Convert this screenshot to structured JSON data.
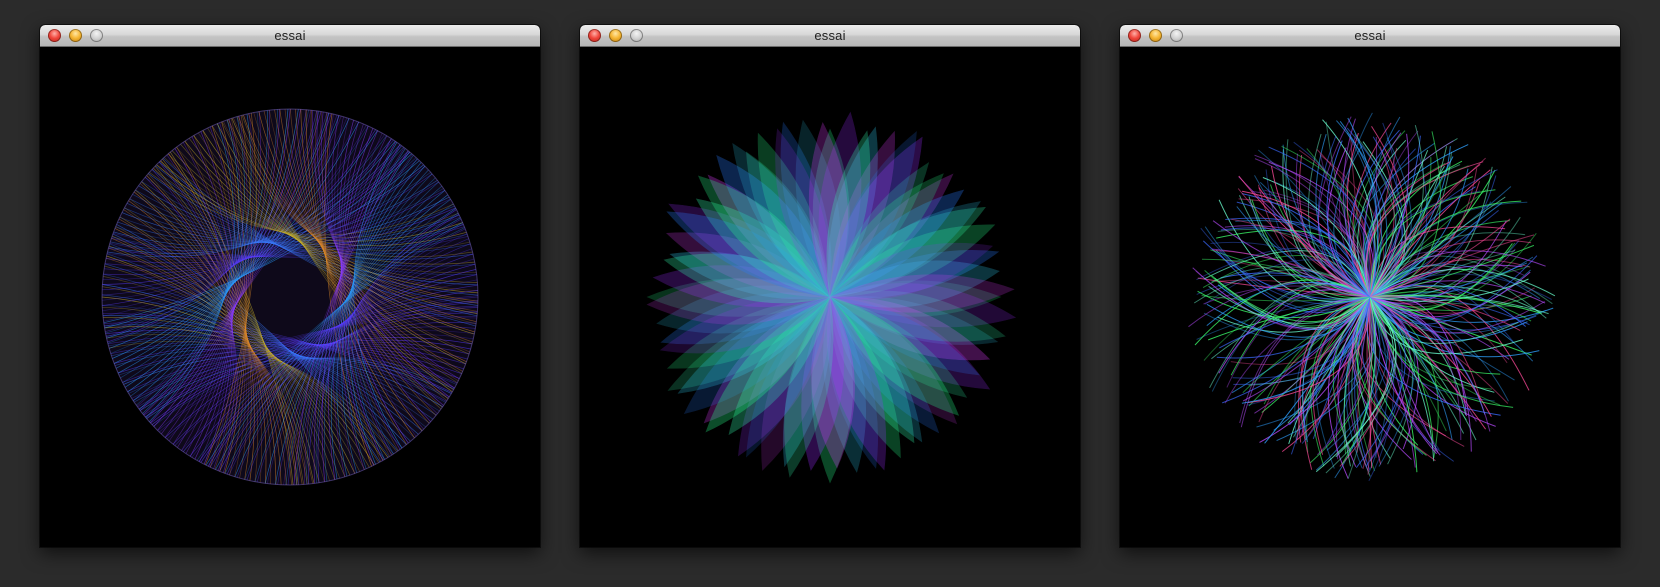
{
  "windows": [
    {
      "title": "essai",
      "artwork": {
        "style": "string-art-circle",
        "palette": [
          "#5a3cff",
          "#3a7cff",
          "#c8b02a",
          "#e08a2a",
          "#8a3cff",
          "#2a9cff"
        ],
        "petals": 13
      }
    },
    {
      "title": "essai",
      "artwork": {
        "style": "translucent-petal-star",
        "palette": [
          "#2aff8c",
          "#33d8ff",
          "#9b2cff",
          "#e03cff",
          "#35ffb0",
          "#2a7cff"
        ],
        "petals": 24
      }
    },
    {
      "title": "essai",
      "artwork": {
        "style": "colored-strand-burst",
        "palette": [
          "#3cff6a",
          "#2ea0ff",
          "#ff4a9a",
          "#b84aff",
          "#6affd0",
          "#3a6aff"
        ],
        "strands": 360
      }
    }
  ]
}
